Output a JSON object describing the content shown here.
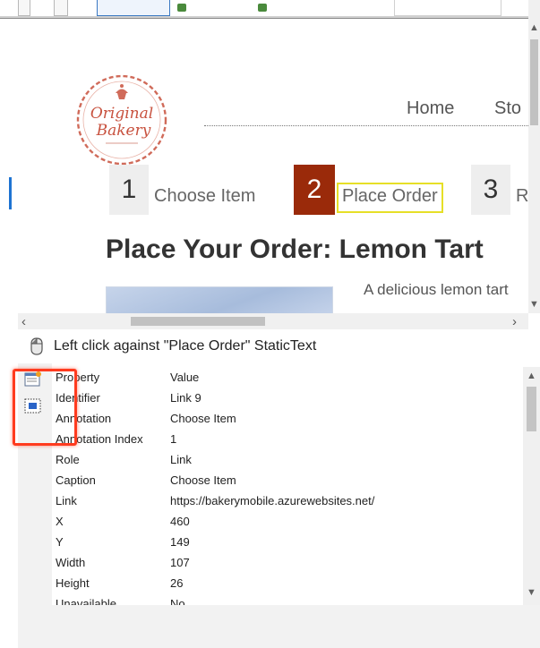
{
  "website": {
    "logo": {
      "line1": "Original",
      "line2": "Bakery",
      "icon": "cupcake-icon"
    },
    "nav": [
      {
        "label": "Home"
      },
      {
        "label": "Sto"
      }
    ],
    "steps": [
      {
        "number": "1",
        "label": "Choose Item"
      },
      {
        "number": "2",
        "label": "Place Order"
      },
      {
        "number": "3",
        "label": "R"
      }
    ],
    "order_title": "Place Your Order: Lemon Tart",
    "product_description": "A delicious lemon tart",
    "colors": {
      "active_step": "#9a2a0a",
      "highlight": "#e6df27"
    }
  },
  "action": {
    "icon": "mouse-icon",
    "text": "Left click against \"Place Order\" StaticText"
  },
  "properties": {
    "headers": {
      "property": "Property",
      "value": "Value"
    },
    "rows": [
      {
        "key": "Identifier",
        "value": "Link 9"
      },
      {
        "key": "Annotation",
        "value": "Choose Item"
      },
      {
        "key": "Annotation Index",
        "value": "1"
      },
      {
        "key": "Role",
        "value": "Link"
      },
      {
        "key": "Caption",
        "value": "Choose Item"
      },
      {
        "key": "Link",
        "value": "https://bakerymobile.azurewebsites.net/"
      },
      {
        "key": "X",
        "value": "460"
      },
      {
        "key": "Y",
        "value": "149"
      },
      {
        "key": "Width",
        "value": "107"
      },
      {
        "key": "Height",
        "value": "26"
      },
      {
        "key": "Unavailable",
        "value": "No"
      }
    ]
  },
  "side_icons": [
    "properties-icon",
    "screenshot-icon"
  ],
  "highlight_color": "#ff3b1f"
}
